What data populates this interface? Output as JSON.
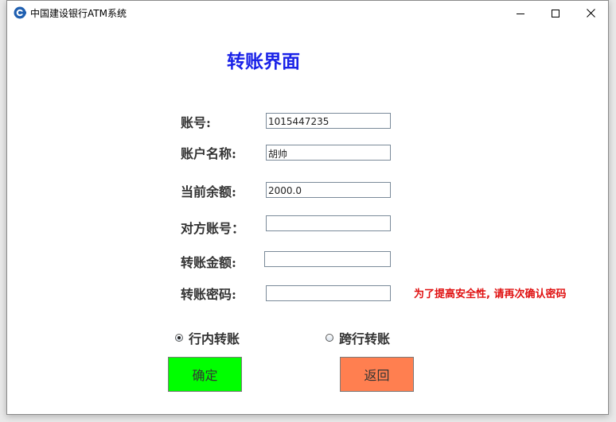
{
  "window": {
    "title": "中国建设银行ATM系统",
    "controls": [
      "minimize-icon",
      "maximize-icon",
      "close-icon"
    ]
  },
  "page": {
    "title": "转账界面"
  },
  "form": {
    "account_label": "账号:",
    "account_value": "1015447235",
    "account_name_label": "账户名称:",
    "account_name_value": "胡帅",
    "balance_label": "当前余额:",
    "balance_value": "2000.0",
    "target_account_label": "对方账号：",
    "target_account_value": "",
    "amount_label": "转账金额:",
    "amount_value": "",
    "password_label": "转账密码:",
    "password_value": "",
    "password_hint": "为了提高安全性, 请再次确认密码"
  },
  "transfer_type": {
    "options": [
      {
        "label": "行内转账",
        "selected": true
      },
      {
        "label": "跨行转账",
        "selected": false
      }
    ]
  },
  "buttons": {
    "confirm_label": "确定",
    "confirm_color": "#00ff00",
    "back_label": "返回",
    "back_color": "#ff7f50"
  },
  "colors": {
    "title": "#1a22e8",
    "hint": "#e01010"
  }
}
